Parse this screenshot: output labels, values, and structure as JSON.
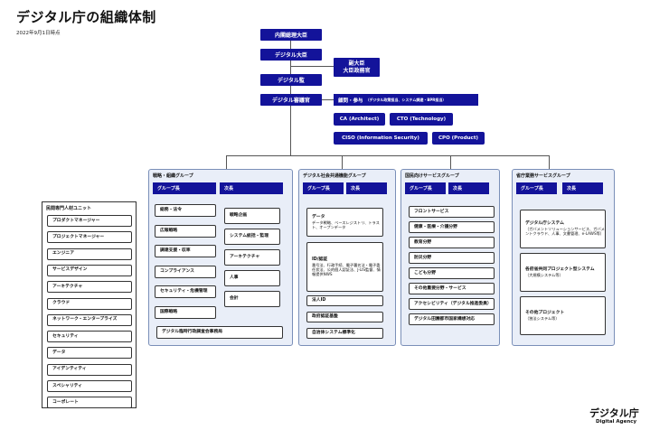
{
  "header": {
    "title": "デジタル庁の組織体制",
    "date": "2022年9月1日時点"
  },
  "top": {
    "cabinet": "内閣総理大臣",
    "minister": "デジタル大臣",
    "vice_minister": "デジタル監",
    "deputy_line1": "副大臣",
    "deputy_line2": "大臣政務官",
    "councilor": "デジタル審議官",
    "advisor_main": "顧問・参与",
    "advisor_detail": "（デジタル政策担当、システム調達・BPR担当）"
  },
  "chiefs": {
    "cao": "CA (Architect)",
    "cto": "CTO (Technology)",
    "ciso": "CISO (Information Security)",
    "cpo": "CPO (Product)"
  },
  "groups": {
    "strategy": {
      "title": "戦略・組織グループ",
      "h1": "グループ長",
      "h2": "次長",
      "col1": [
        "総務・法令",
        "広報戦略",
        "調達支援・収率",
        "コンプライアンス",
        "セキュリティ・危機管理",
        "国際戦略"
      ],
      "col2": [
        "戦略企画",
        "システム統括・監理",
        "アーキテクチャ",
        "人事",
        "会計"
      ],
      "bottom": "デジタル臨時行政調査会事務局"
    },
    "common": {
      "title": "デジタル社会共通機能グループ",
      "h1": "グループ長",
      "h2": "次長",
      "data_title": "データ",
      "data_sub": "データ戦略、ベースレジストリ、トラスト、オープンデータ",
      "id_title": "ID/認証",
      "id_sub": "番号法、行政手続、電子署名法・電子委任状法、公的個人認証法、J-LIS監督、情報提供NWS",
      "items": [
        "法人ID",
        "政府認証基盤",
        "自治体システム標準化"
      ]
    },
    "citizen": {
      "title": "国民向けサービスグループ",
      "h1": "グループ長",
      "h2": "次長",
      "items": [
        "フロントサービス",
        "健康・医療・介護分野",
        "教育分野",
        "防災分野",
        "こども分野",
        "その他重要分野・サービス",
        "アクセシビリティ（デジタル推進委員）",
        "デジタル田園都市国家構想対応"
      ]
    },
    "agency": {
      "title": "省庁業務サービスグループ",
      "h1": "グループ長",
      "h2": "次長",
      "item1_title": "デジタル庁システム",
      "item1_sub": "（ガバメントソリューションサービス、ガバメントクラウド、人事、文書管理、e-LAWS等）",
      "item2_title": "各府省共同プロジェクト型システム",
      "item2_sub": "（大規模システム等）",
      "item3_title": "その他プロジェクト",
      "item3_sub": "（独法システム等）"
    }
  },
  "experts": {
    "title": "民間専門人材ユニット",
    "items": [
      "プロダクトマネージャー",
      "プロジェクトマネージャー",
      "エンジニア",
      "サービスデザイン",
      "アーキテクチャ",
      "クラウド",
      "ネットワーク・エンタープライズ",
      "セキュリティ",
      "データ",
      "アイデンティティ",
      "スペシャリティ",
      "コーポレート"
    ]
  },
  "logo": {
    "main": "デジタル庁",
    "sub": "Digital Agency"
  },
  "colors": {
    "navy": "#13139a",
    "group_bg": "#e9eef8",
    "group_border": "#7a8fb8"
  }
}
